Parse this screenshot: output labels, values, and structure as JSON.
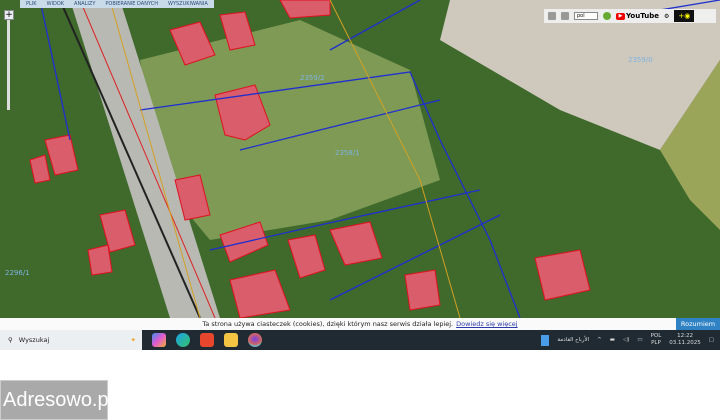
{
  "map": {
    "menu": [
      "PLIK",
      "WIDOK",
      "ANALIZY",
      "POBIERANIE DANYCH",
      "WYSZUKIWANIA"
    ],
    "zoom_in_label": "+",
    "parcel_labels": [
      "2359/0",
      "2358/1",
      "2359/2",
      "2296/1"
    ],
    "toolbar": {
      "language_select": "pol",
      "youtube_label": "YouTube",
      "icons": [
        "print-icon",
        "green-dot-icon",
        "gear-icon",
        "brightness-icon"
      ]
    }
  },
  "cookie_bar": {
    "text": "Ta strona używa ciasteczek (cookies), dzięki którym nasz serwis działa lepiej.",
    "link": "Dowiedz się więcej",
    "accept": "Rozumiem"
  },
  "taskbar": {
    "search_placeholder": "Wyszukaj",
    "apps": [
      "copilot",
      "edge",
      "brave",
      "file-explorer",
      "firefox"
    ],
    "news_text": "الأرباح القادمة",
    "lang_top": "POL",
    "lang_bottom": "PLP",
    "time": "12:22",
    "date": "03.11.2025"
  },
  "watermark": "Adresowo.pl",
  "colors": {
    "accent": "#2f82c4",
    "taskbar": "#1f2a33",
    "building": "#d9374a",
    "boundary": "#1f2fd0"
  }
}
